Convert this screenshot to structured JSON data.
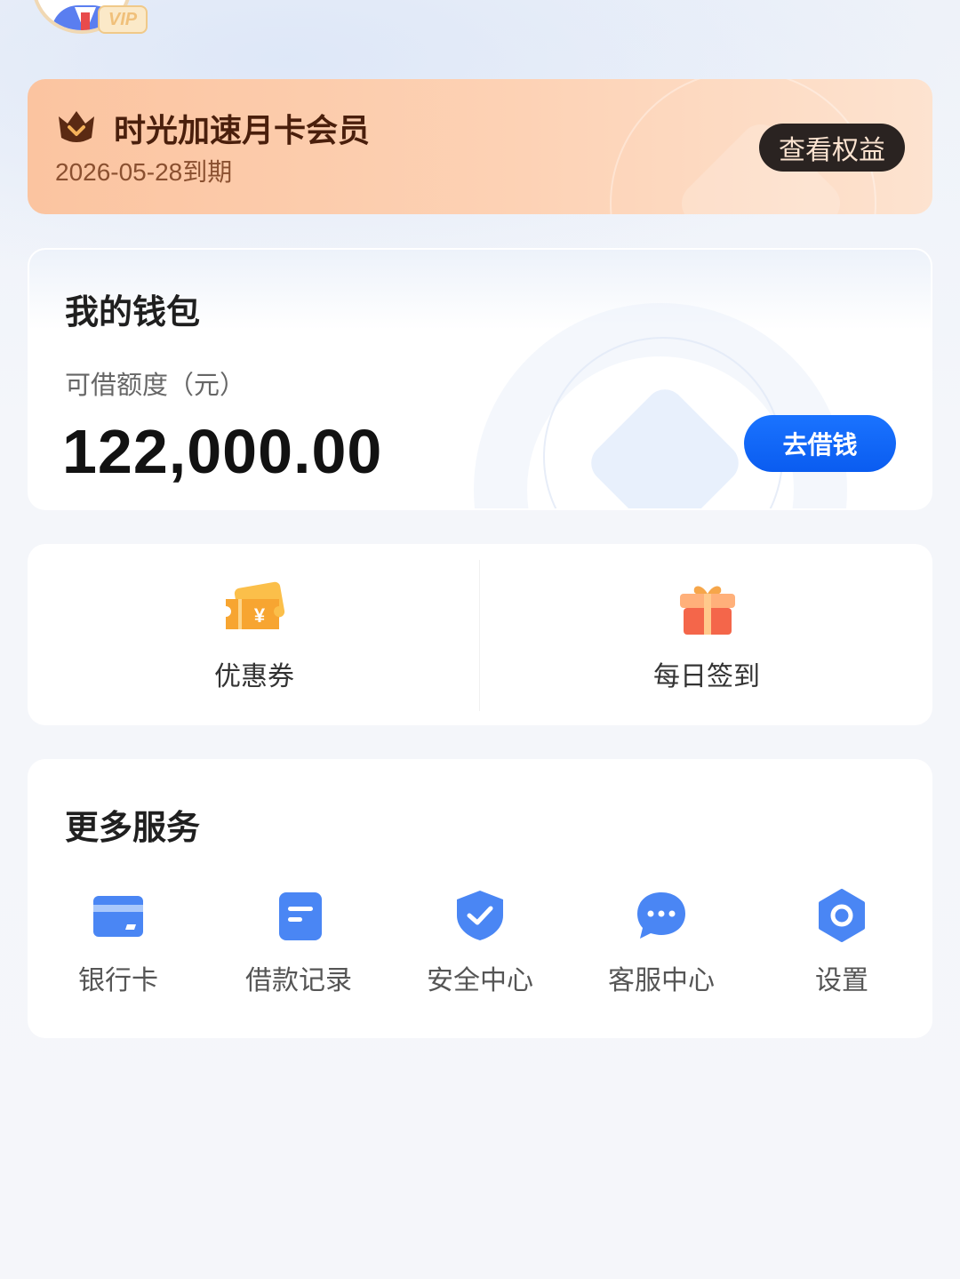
{
  "header": {
    "vip_badge": "VIP"
  },
  "membership": {
    "title": "时光加速月卡会员",
    "expire": "2026-05-28到期",
    "benefit_button": "查看权益"
  },
  "wallet": {
    "title": "我的钱包",
    "credit_label": "可借额度（元）",
    "credit_amount": "122,000.00",
    "borrow_button": "去借钱"
  },
  "quick_actions": [
    {
      "label": "优惠券",
      "icon": "coupon-icon"
    },
    {
      "label": "每日签到",
      "icon": "gift-icon"
    }
  ],
  "services": {
    "title": "更多服务",
    "items": [
      {
        "label": "银行卡",
        "icon": "bank-card-icon"
      },
      {
        "label": "借款记录",
        "icon": "record-icon"
      },
      {
        "label": "安全中心",
        "icon": "shield-icon"
      },
      {
        "label": "客服中心",
        "icon": "chat-icon"
      },
      {
        "label": "设置",
        "icon": "gear-icon"
      }
    ]
  },
  "colors": {
    "accent_blue": "#0a64f5",
    "icon_blue": "#4a86f4",
    "member_dark": "#4a1f0c",
    "benefit_button_bg": "#2a2321"
  }
}
